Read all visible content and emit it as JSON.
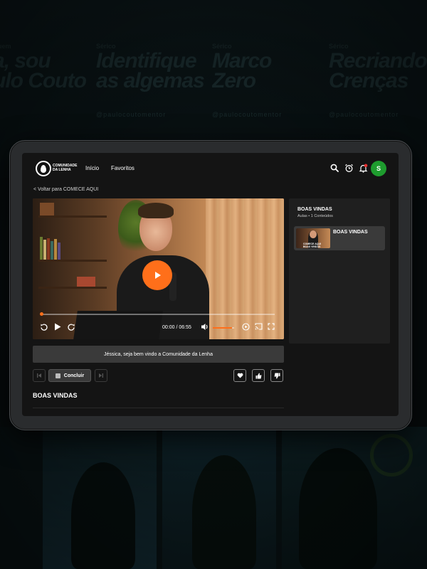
{
  "background": {
    "posters": [
      {
        "subtitle": "Quem",
        "title_line1": "a, sou",
        "title_line2": "ulo Couto"
      },
      {
        "subtitle": "Sérico",
        "title_line1": "Identifique",
        "title_line2": "as algemas"
      },
      {
        "subtitle": "Sérico",
        "title_line1": "Marco",
        "title_line2": "Zero"
      },
      {
        "subtitle": "Sérico",
        "title_line1": "Recriando",
        "title_line2": "Crenças"
      }
    ],
    "handle": "@paulocoutomentor"
  },
  "header": {
    "logo_line1": "COMUNIDADE",
    "logo_line2": "DA LENHA",
    "nav": [
      "Início",
      "Favoritos"
    ],
    "avatar_initial": "S"
  },
  "back_link": "< Voltar para COMECE AQUI",
  "video": {
    "current_time": "00:00",
    "separator": "/",
    "duration": "06:55",
    "progress": 0.0,
    "volume": 0.9
  },
  "sidebar": {
    "title": "BOAS VINDAS",
    "subtitle": "Aulas • 1 Conteúdos",
    "lessons": [
      {
        "title": "BOAS VINDAS",
        "thumb_line1": "COMECE AQUI",
        "thumb_line2": "BOAS VINDAS"
      }
    ]
  },
  "welcome_message": "Jéssica, seja bem vindo a Comunidade da Lenha",
  "actions": {
    "complete_label": "Concluir"
  },
  "section_title": "BOAS VINDAS",
  "colors": {
    "accent": "#ff6f1a",
    "avatar": "#1e9c2e",
    "notification": "#e63030"
  }
}
